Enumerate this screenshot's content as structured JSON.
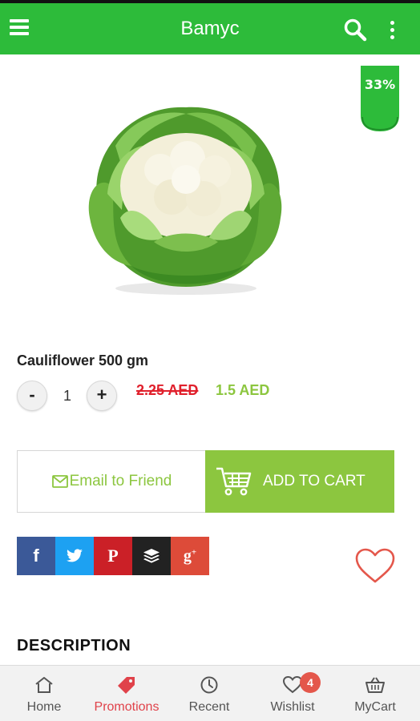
{
  "app": {
    "title": "Вamyc"
  },
  "product": {
    "name": "Cauliflower 500 gm",
    "discount": "33%",
    "quantity": "1",
    "old_price": "2.25 AED",
    "new_price": "1.5 AED"
  },
  "actions": {
    "email_label": "Email to Friend",
    "cart_label": "ADD TO CART"
  },
  "share": [
    {
      "glyph": "f",
      "color": "#3b5998",
      "icon": "facebook-icon"
    },
    {
      "glyph": "t",
      "color": "#1da1f2",
      "icon": "twitter-icon"
    },
    {
      "glyph": "p",
      "color": "#cb2027",
      "icon": "pinterest-icon"
    },
    {
      "glyph": "b",
      "color": "#222222",
      "icon": "buffer-icon"
    },
    {
      "glyph": "g+",
      "color": "#dd4b39",
      "icon": "google-plus-icon"
    }
  ],
  "description": {
    "heading": "DESCRIPTION"
  },
  "nav": {
    "items": [
      {
        "label": "Home",
        "icon": "home-icon"
      },
      {
        "label": "Promotions",
        "icon": "tag-icon"
      },
      {
        "label": "Recent",
        "icon": "clock-icon"
      },
      {
        "label": "Wishlist",
        "icon": "heart-icon"
      },
      {
        "label": "MyCart",
        "icon": "basket-icon"
      }
    ],
    "active": "Promotions",
    "wishlist_badge": "4"
  },
  "colors": {
    "appbar": "#2dbb3a",
    "accent_green": "#8cc63f",
    "strike_red": "#e0202c",
    "active_nav": "#e0424a"
  }
}
